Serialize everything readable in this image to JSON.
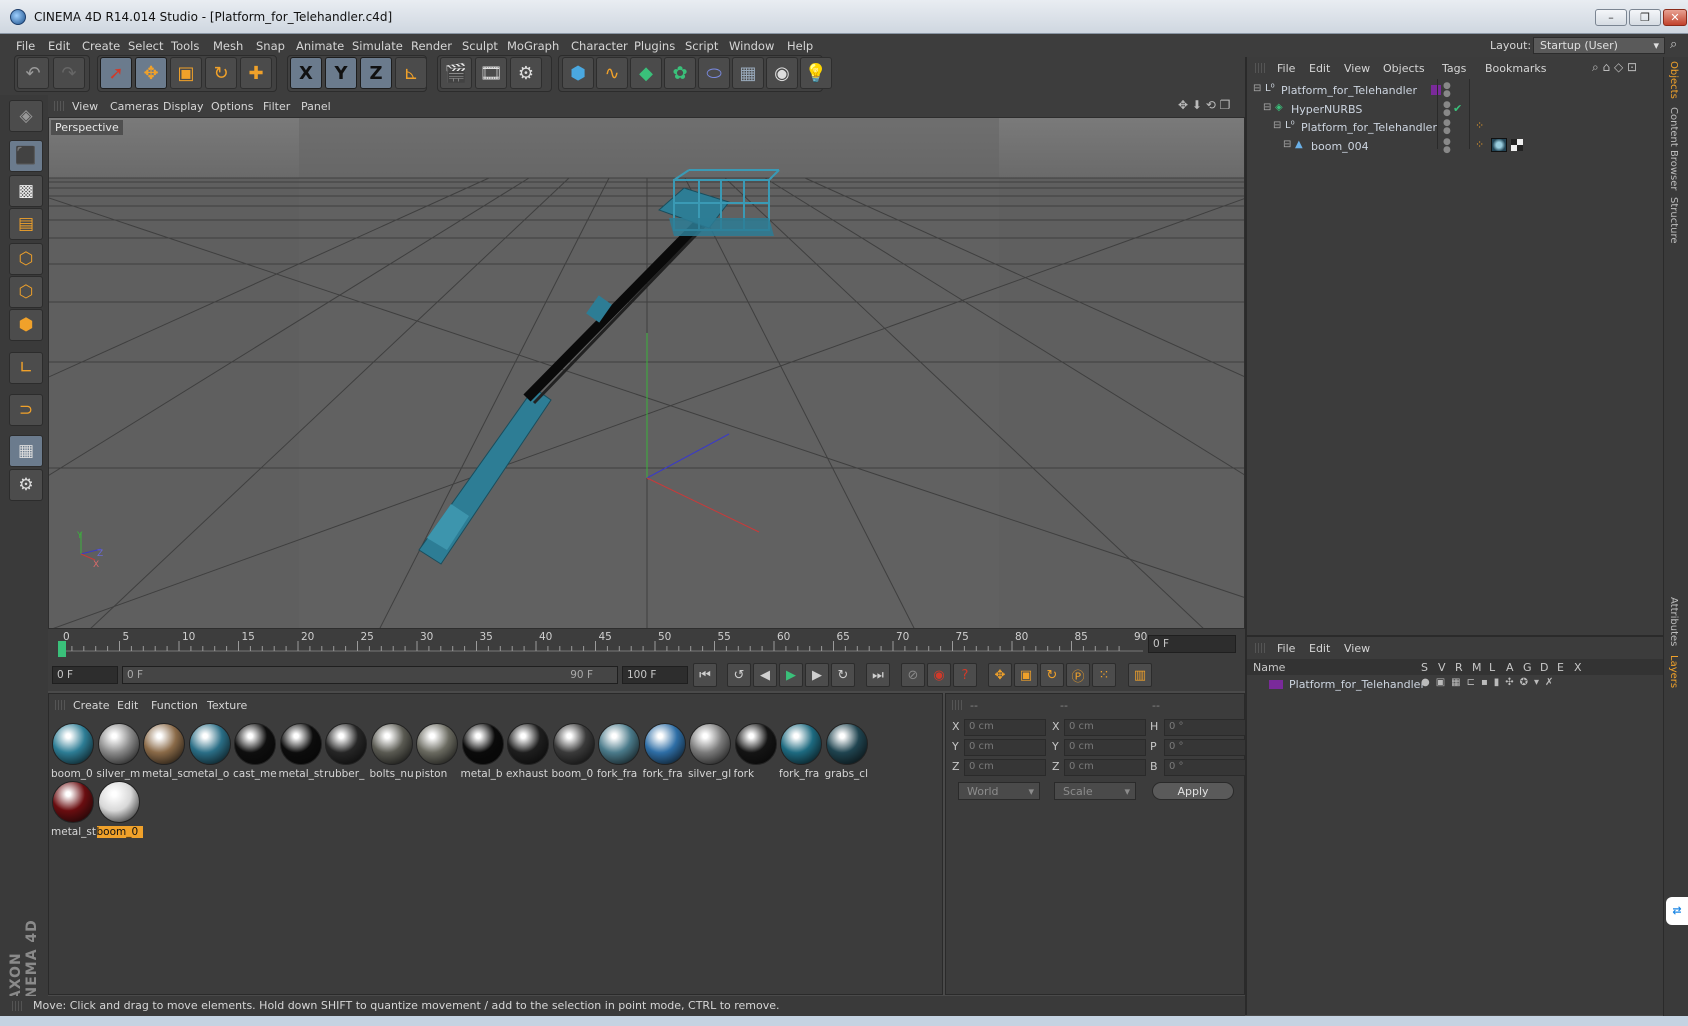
{
  "window": {
    "title": "CINEMA 4D R14.014 Studio - [Platform_for_Telehandler.c4d]",
    "buttons": [
      "–",
      "❐",
      "✕"
    ]
  },
  "menubar": {
    "items": [
      "File",
      "Edit",
      "Create",
      "Select",
      "Tools",
      "Mesh",
      "Snap",
      "Animate",
      "Simulate",
      "Render",
      "Sculpt",
      "MoGraph",
      "Character",
      "Plugins",
      "Script",
      "Window",
      "Help"
    ],
    "layout_label": "Layout:",
    "layout_value": "Startup (User)"
  },
  "toolbar": {
    "icons": [
      "undo-icon",
      "redo-icon",
      "select-pointer-icon",
      "move-icon",
      "scale-icon",
      "rotate-icon",
      "live-selection-icon",
      "x-axis-icon",
      "y-axis-icon",
      "z-axis-icon",
      "coordinate-system-icon",
      "render-view-icon",
      "render-picture-viewer-icon",
      "render-settings-icon",
      "cube-icon",
      "spline-icon",
      "nurbs-icon",
      "array-icon",
      "deformer-icon",
      "floor-icon",
      "camera-icon",
      "light-icon"
    ],
    "xyz": [
      "X",
      "Y",
      "Z"
    ]
  },
  "viewport": {
    "menu": [
      "View",
      "Cameras",
      "Display",
      "Options",
      "Filter",
      "Panel"
    ],
    "label": "Perspective",
    "axis_labels": {
      "x": "X",
      "y": "Y",
      "z": "Z"
    }
  },
  "timeline": {
    "ticks": [
      "0",
      "5",
      "10",
      "15",
      "20",
      "25",
      "30",
      "35",
      "40",
      "45",
      "50",
      "55",
      "60",
      "65",
      "70",
      "75",
      "80",
      "85",
      "90"
    ],
    "current_frame": "0 F",
    "start_field": "0 F",
    "range_start": "0 F",
    "range_end": "90 F",
    "end_field": "100 F"
  },
  "materials": {
    "menu": [
      "Create",
      "Edit",
      "Function",
      "Texture"
    ],
    "items": [
      {
        "label": "boom_0",
        "color": "#2d7d95"
      },
      {
        "label": "silver_m",
        "color": "#8a8a8a"
      },
      {
        "label": "metal_sc",
        "color": "#8a6a48"
      },
      {
        "label": "metal_o",
        "color": "#2a6e86"
      },
      {
        "label": "cast_me",
        "color": "#0e0e0e"
      },
      {
        "label": "metal_st",
        "color": "#0c0c0c"
      },
      {
        "label": "rubber_",
        "color": "#262626"
      },
      {
        "label": "bolts_nu",
        "color": "#5a5a52"
      },
      {
        "label": "piston",
        "color": "#6a6a60"
      },
      {
        "label": "metal_b",
        "color": "#0a0a0a"
      },
      {
        "label": "exhaust",
        "color": "#1e1e1e"
      },
      {
        "label": "boom_0",
        "color": "#3a3a3a"
      },
      {
        "label": "fork_fra",
        "color": "#4a7a8a"
      },
      {
        "label": "fork_fra",
        "color": "#2e6ea6"
      },
      {
        "label": "silver_gl",
        "color": "#7a7a7a"
      },
      {
        "label": "fork",
        "color": "#141414"
      },
      {
        "label": "fork_fra",
        "color": "#1d6a80"
      },
      {
        "label": "grabs_cl",
        "color": "#1f4450"
      },
      {
        "label": "metal_st",
        "color": "#6a0d10"
      },
      {
        "label": "boom_0",
        "color": "#d8d8d8"
      }
    ],
    "selected_index": 19
  },
  "coordinates": {
    "headers": [
      "--",
      "--",
      "--"
    ],
    "rows": [
      {
        "axis": "X",
        "pos": "0 cm",
        "axis2": "X",
        "size": "0 cm",
        "rot_label": "H",
        "rot": "0 °"
      },
      {
        "axis": "Y",
        "pos": "0 cm",
        "axis2": "Y",
        "size": "0 cm",
        "rot_label": "P",
        "rot": "0 °"
      },
      {
        "axis": "Z",
        "pos": "0 cm",
        "axis2": "Z",
        "size": "0 cm",
        "rot_label": "B",
        "rot": "0 °"
      }
    ],
    "mode": "World",
    "scale": "Scale",
    "apply": "Apply"
  },
  "objects": {
    "menu": [
      "File",
      "Edit",
      "View",
      "Objects",
      "Tags",
      "Bookmarks"
    ],
    "tree": [
      {
        "name": "Platform_for_Telehandler",
        "indent": 0,
        "icon": "null-object-icon"
      },
      {
        "name": "HyperNURBS",
        "indent": 1,
        "icon": "hypernurbs-icon"
      },
      {
        "name": "Platform_for_Telehandler",
        "indent": 2,
        "icon": "null-object-icon"
      },
      {
        "name": "boom_004",
        "indent": 3,
        "icon": "polygon-object-icon"
      }
    ]
  },
  "layers": {
    "menu": [
      "File",
      "Edit",
      "View"
    ],
    "columns": [
      "Name",
      "S",
      "V",
      "R",
      "M",
      "L",
      "A",
      "G",
      "D",
      "E",
      "X"
    ],
    "rows": [
      {
        "name": "Platform_for_Telehandler",
        "color": "#7a2a9a"
      }
    ]
  },
  "right_tabs": [
    "Objects",
    "Content Browser",
    "Structure",
    "Attributes",
    "Layers"
  ],
  "status": "Move: Click and drag to move elements. Hold down SHIFT to quantize movement / add to the selection in point mode, CTRL to remove.",
  "brand": "MAXON CINEMA 4D",
  "colors": {
    "accent": "#f0a12a",
    "teal": "#2d7d95",
    "panel": "#3c3c3c"
  }
}
